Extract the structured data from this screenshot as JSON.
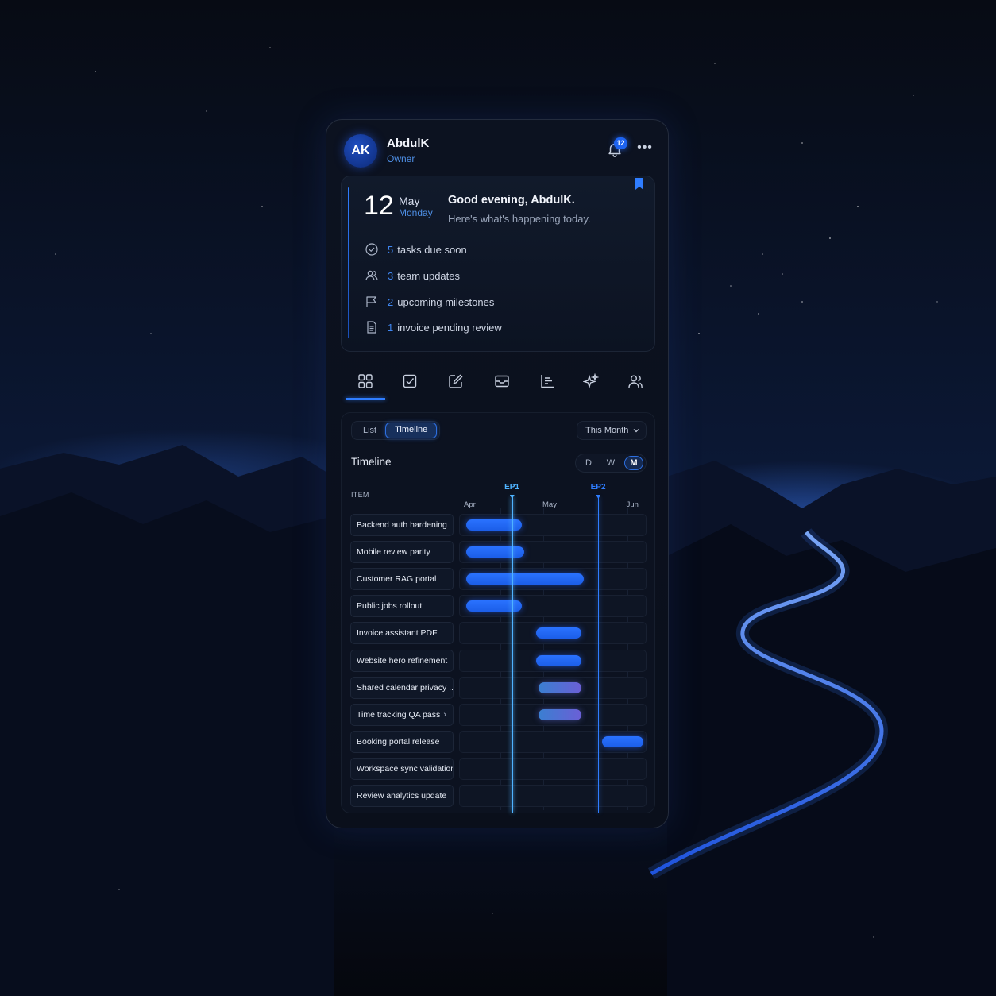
{
  "user": {
    "initials": "AK",
    "name": "AbdulK",
    "role": "Owner"
  },
  "notifications": {
    "count": "12"
  },
  "summary": {
    "day": "12",
    "month": "May",
    "weekday": "Monday",
    "greeting": "Good evening, AbdulK.",
    "subtitle": "Here's what's happening today.",
    "items": [
      {
        "count": "5",
        "text": "tasks due soon",
        "icon": "check-circle-icon"
      },
      {
        "count": "3",
        "text": "team updates",
        "icon": "users-icon"
      },
      {
        "count": "2",
        "text": "upcoming milestones",
        "icon": "flag-icon"
      },
      {
        "count": "1",
        "text": "invoice pending review",
        "icon": "document-icon"
      }
    ]
  },
  "nav": [
    "grid-icon",
    "checkbox-icon",
    "edit-icon",
    "inbox-icon",
    "chart-icon",
    "sparkle-icon",
    "users-icon"
  ],
  "timeline": {
    "view_tabs": [
      "List",
      "Timeline"
    ],
    "active_view": "Timeline",
    "range": "This Month",
    "title": "Timeline",
    "scales": [
      "D",
      "W",
      "M"
    ],
    "active_scale": "M",
    "item_header": "ITEM",
    "months": [
      "Apr",
      "May",
      "Jun"
    ],
    "milestones": [
      {
        "label": "EP1",
        "color": "#4fb3ff"
      },
      {
        "label": "EP2",
        "color": "#2f7dff"
      }
    ]
  },
  "chart_data": {
    "type": "gantt",
    "x_axis": [
      "Apr",
      "May",
      "Jun"
    ],
    "milestones": [
      {
        "name": "EP1",
        "position": 0.28
      },
      {
        "name": "EP2",
        "position": 0.74
      }
    ],
    "rows": [
      {
        "name": "Backend auth hardening",
        "start": 0.02,
        "end": 0.33,
        "style": "solid"
      },
      {
        "name": "Mobile review parity",
        "start": 0.02,
        "end": 0.34,
        "style": "solid"
      },
      {
        "name": "Customer RAG portal",
        "start": 0.02,
        "end": 0.67,
        "style": "solid"
      },
      {
        "name": "Public jobs rollout",
        "start": 0.02,
        "end": 0.33,
        "style": "solid"
      },
      {
        "name": "Invoice assistant PDF",
        "start": 0.41,
        "end": 0.66,
        "style": "solid"
      },
      {
        "name": "Website hero refinement",
        "start": 0.41,
        "end": 0.66,
        "style": "solid"
      },
      {
        "name": "Shared calendar privacy ...",
        "start": 0.42,
        "end": 0.66,
        "style": "gradient"
      },
      {
        "name": "Time tracking QA pass",
        "start": 0.42,
        "end": 0.66,
        "style": "gradient",
        "expand": true
      },
      {
        "name": "Booking portal release",
        "start": 0.77,
        "end": 1.0,
        "style": "solid"
      },
      {
        "name": "Workspace sync validation",
        "start": null,
        "end": null,
        "style": "none"
      },
      {
        "name": "Review analytics update",
        "start": null,
        "end": null,
        "style": "none"
      }
    ]
  },
  "colors": {
    "accent": "#2f7dff",
    "bar_solid": "#1c5ee8",
    "bar_gradient_start": "#3a7fd1",
    "bar_gradient_end": "#6b5fd6"
  }
}
